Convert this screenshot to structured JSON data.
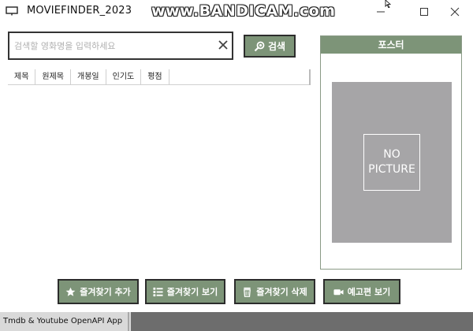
{
  "window": {
    "title": "MOVIEFINDER_2023",
    "watermark": "www.BANDICAM.com",
    "controls": {
      "minimize": "minimize",
      "maximize": "maximize",
      "close": "close"
    }
  },
  "search": {
    "placeholder": "검색할 영화명을 입력하세요",
    "value": "",
    "button_label": "검색"
  },
  "table": {
    "columns": [
      "제목",
      "원제목",
      "개봉일",
      "인기도",
      "평점"
    ],
    "rows": []
  },
  "poster": {
    "title": "포스터",
    "no_picture_line1": "NO",
    "no_picture_line2": "PICTURE"
  },
  "actions": {
    "add_favorite": "즐겨찾기 추가",
    "view_favorites": "즐겨찾기 보기",
    "delete_favorite": "즐겨찾기 삭제",
    "trailer": "예고편  보기"
  },
  "status": {
    "text": "Tmdb & Youtube OpenAPI App"
  },
  "colors": {
    "accent": "#7d9478",
    "poster_bg": "#a6a5a7",
    "statusbar": "#6d6d6d"
  }
}
